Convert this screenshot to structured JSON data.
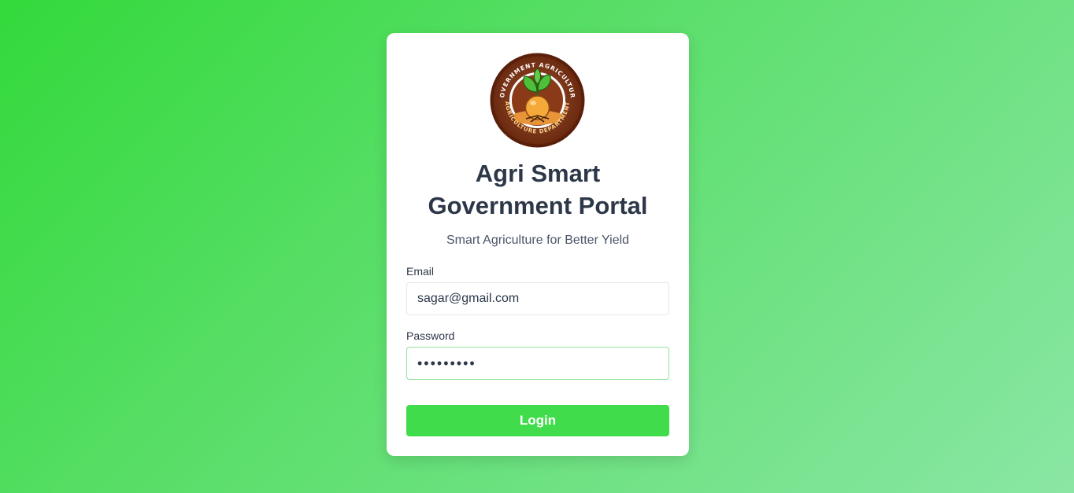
{
  "logo": {
    "icon": "agriculture-department-seal-icon",
    "ring_text_top": "GOVERNMENT AGRICULTURE",
    "ring_text_bottom": "AGRICULTURE DEPARTMENT"
  },
  "title": "Agri Smart Government Portal",
  "subtitle": "Smart Agriculture for Better Yield",
  "form": {
    "email_label": "Email",
    "email_value": "sagar@gmail.com",
    "password_label": "Password",
    "password_value": "•••••••••",
    "login_label": "Login"
  },
  "colors": {
    "accent": "#40dc4b",
    "background_start": "#33d93b",
    "background_end": "#8ae6a4",
    "text": "#2d3748"
  }
}
